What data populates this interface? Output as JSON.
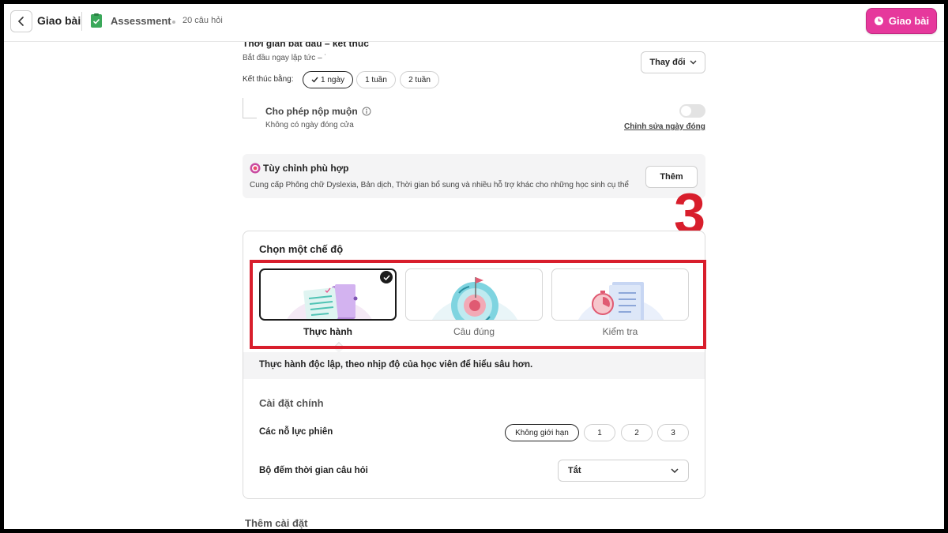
{
  "topbar": {
    "title": "Giao bài",
    "assessment_label": "Assessment",
    "question_count": "20 câu hỏi",
    "assign_button": "Giao bài"
  },
  "schedule": {
    "heading": "Thời gian bắt đầu – kết thúc",
    "start_text": "Bắt đầu ngay lập tức  –  ˙",
    "change_button": "Thay đổi",
    "end_by_label": "Kết thúc bằng:",
    "end_options": [
      {
        "label": "1 ngày",
        "selected": true
      },
      {
        "label": "1 tuần",
        "selected": false
      },
      {
        "label": "2 tuần",
        "selected": false
      }
    ]
  },
  "late_submission": {
    "label": "Cho phép nộp muộn",
    "sublabel": "Không có ngày đóng cửa",
    "edit_link": "Chỉnh sửa ngày đóng",
    "enabled": false
  },
  "accommodations": {
    "title": "Tùy chỉnh phù hợp",
    "description": "Cung cấp Phông chữ Dyslexia, Bản dịch, Thời gian bổ sung và nhiều hỗ trợ khác cho những học sinh cụ thể",
    "add_button": "Thêm"
  },
  "annotation_number": "3",
  "mode": {
    "heading": "Chọn một chế độ",
    "options": [
      {
        "label": "Thực hành",
        "selected": true
      },
      {
        "label": "Câu đúng",
        "selected": false
      },
      {
        "label": "Kiểm tra",
        "selected": false
      }
    ],
    "description": "Thực hành độc lập, theo nhịp độ của học viên để hiểu sâu hơn."
  },
  "main_settings": {
    "heading": "Cài đặt chính",
    "attempts_label": "Các nỗ lực phiên",
    "attempt_options": [
      {
        "label": "Không giới hạn",
        "selected": true
      },
      {
        "label": "1",
        "selected": false
      },
      {
        "label": "2",
        "selected": false
      },
      {
        "label": "3",
        "selected": false
      }
    ],
    "timer_label": "Bộ đếm thời gian câu hỏi",
    "timer_value": "Tắt"
  },
  "more_settings": {
    "heading": "Thêm cài đặt"
  },
  "colors": {
    "accent_pink": "#e6389c",
    "annotation_red": "#d81e2c"
  }
}
